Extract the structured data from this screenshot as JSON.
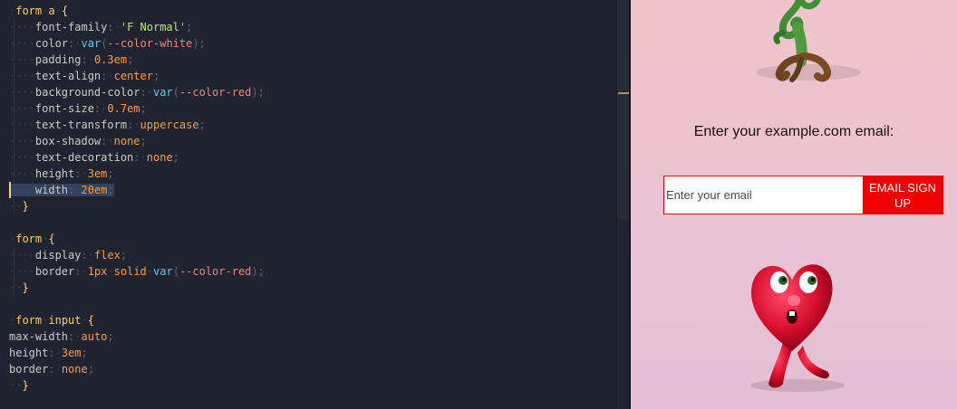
{
  "editor": {
    "lines": [
      [
        {
          "t": "·",
          "c": "ws"
        },
        {
          "t": "form",
          "c": "sel"
        },
        {
          "t": "·",
          "c": "ws"
        },
        {
          "t": "a",
          "c": "sel"
        },
        {
          "t": "·",
          "c": "ws"
        },
        {
          "t": "{",
          "c": "brace"
        }
      ],
      [
        {
          "t": "····",
          "c": "ws"
        },
        {
          "t": "font-family",
          "c": "prop"
        },
        {
          "t": ":",
          "c": "punc"
        },
        {
          "t": "·",
          "c": "ws"
        },
        {
          "t": "'F Normal'",
          "c": "str"
        },
        {
          "t": ";",
          "c": "punc"
        }
      ],
      [
        {
          "t": "····",
          "c": "ws"
        },
        {
          "t": "color",
          "c": "prop"
        },
        {
          "t": ":",
          "c": "punc"
        },
        {
          "t": "·",
          "c": "ws"
        },
        {
          "t": "var",
          "c": "fn"
        },
        {
          "t": "(",
          "c": "punc"
        },
        {
          "t": "--color-white",
          "c": "varname"
        },
        {
          "t": ");",
          "c": "punc"
        }
      ],
      [
        {
          "t": "····",
          "c": "ws"
        },
        {
          "t": "padding",
          "c": "prop"
        },
        {
          "t": ":",
          "c": "punc"
        },
        {
          "t": "·",
          "c": "ws"
        },
        {
          "t": "0.3em",
          "c": "val"
        },
        {
          "t": ";",
          "c": "punc"
        }
      ],
      [
        {
          "t": "····",
          "c": "ws"
        },
        {
          "t": "text-align",
          "c": "prop"
        },
        {
          "t": ":",
          "c": "punc"
        },
        {
          "t": "·",
          "c": "ws"
        },
        {
          "t": "center",
          "c": "val"
        },
        {
          "t": ";",
          "c": "punc"
        }
      ],
      [
        {
          "t": "····",
          "c": "ws"
        },
        {
          "t": "background-color",
          "c": "prop"
        },
        {
          "t": ":",
          "c": "punc"
        },
        {
          "t": "·",
          "c": "ws"
        },
        {
          "t": "var",
          "c": "fn"
        },
        {
          "t": "(",
          "c": "punc"
        },
        {
          "t": "--color-red",
          "c": "varname"
        },
        {
          "t": ");",
          "c": "punc"
        }
      ],
      [
        {
          "t": "····",
          "c": "ws"
        },
        {
          "t": "font-size",
          "c": "prop"
        },
        {
          "t": ":",
          "c": "punc"
        },
        {
          "t": "·",
          "c": "ws"
        },
        {
          "t": "0.7em",
          "c": "val"
        },
        {
          "t": ";",
          "c": "punc"
        }
      ],
      [
        {
          "t": "····",
          "c": "ws"
        },
        {
          "t": "text-transform",
          "c": "prop"
        },
        {
          "t": ":",
          "c": "punc"
        },
        {
          "t": "·",
          "c": "ws"
        },
        {
          "t": "uppercase",
          "c": "val"
        },
        {
          "t": ";",
          "c": "punc"
        }
      ],
      [
        {
          "t": "····",
          "c": "ws"
        },
        {
          "t": "box-shadow",
          "c": "prop"
        },
        {
          "t": ":",
          "c": "punc"
        },
        {
          "t": "·",
          "c": "ws"
        },
        {
          "t": "none",
          "c": "val"
        },
        {
          "t": ";",
          "c": "punc"
        }
      ],
      [
        {
          "t": "····",
          "c": "ws"
        },
        {
          "t": "text-decoration",
          "c": "prop"
        },
        {
          "t": ":",
          "c": "punc"
        },
        {
          "t": "·",
          "c": "ws"
        },
        {
          "t": "none",
          "c": "val"
        },
        {
          "t": ";",
          "c": "punc"
        }
      ],
      [
        {
          "t": "····",
          "c": "ws"
        },
        {
          "t": "height",
          "c": "prop"
        },
        {
          "t": ":",
          "c": "punc"
        },
        {
          "t": "·",
          "c": "ws"
        },
        {
          "t": "3em",
          "c": "val"
        },
        {
          "t": ";",
          "c": "punc"
        }
      ],
      [
        {
          "t": "····",
          "c": "ws"
        },
        {
          "t": "width",
          "c": "prop"
        },
        {
          "t": ":",
          "c": "punc"
        },
        {
          "t": "·",
          "c": "ws"
        },
        {
          "t": "20em",
          "c": "val"
        },
        {
          "t": ";",
          "c": "punc"
        }
      ],
      [
        {
          "t": "··",
          "c": "ws"
        },
        {
          "t": "}",
          "c": "brace"
        }
      ],
      [],
      [
        {
          "t": "·",
          "c": "ws"
        },
        {
          "t": "form",
          "c": "sel"
        },
        {
          "t": "·",
          "c": "ws"
        },
        {
          "t": "{",
          "c": "brace"
        }
      ],
      [
        {
          "t": "····",
          "c": "ws"
        },
        {
          "t": "display",
          "c": "prop"
        },
        {
          "t": ":",
          "c": "punc"
        },
        {
          "t": "·",
          "c": "ws"
        },
        {
          "t": "flex",
          "c": "val"
        },
        {
          "t": ";",
          "c": "punc"
        }
      ],
      [
        {
          "t": "····",
          "c": "ws"
        },
        {
          "t": "border",
          "c": "prop"
        },
        {
          "t": ":",
          "c": "punc"
        },
        {
          "t": "·",
          "c": "ws"
        },
        {
          "t": "1px",
          "c": "val"
        },
        {
          "t": "·",
          "c": "ws"
        },
        {
          "t": "solid",
          "c": "val"
        },
        {
          "t": "·",
          "c": "ws"
        },
        {
          "t": "var",
          "c": "fn"
        },
        {
          "t": "(",
          "c": "punc"
        },
        {
          "t": "--color-red",
          "c": "varname"
        },
        {
          "t": ");",
          "c": "punc"
        }
      ],
      [
        {
          "t": "··",
          "c": "ws"
        },
        {
          "t": "}",
          "c": "brace"
        }
      ],
      [],
      [
        {
          "t": "·",
          "c": "ws"
        },
        {
          "t": "form",
          "c": "sel"
        },
        {
          "t": "·",
          "c": "ws"
        },
        {
          "t": "input",
          "c": "sel"
        },
        {
          "t": "·",
          "c": "ws"
        },
        {
          "t": "{",
          "c": "brace"
        }
      ],
      [
        {
          "t": "max-width",
          "c": "prop"
        },
        {
          "t": ":",
          "c": "punc"
        },
        {
          "t": "·",
          "c": "ws"
        },
        {
          "t": "auto",
          "c": "val"
        },
        {
          "t": ";",
          "c": "punc"
        }
      ],
      [
        {
          "t": "height",
          "c": "prop"
        },
        {
          "t": ":",
          "c": "punc"
        },
        {
          "t": "·",
          "c": "ws"
        },
        {
          "t": "3em",
          "c": "val"
        },
        {
          "t": ";",
          "c": "punc"
        }
      ],
      [
        {
          "t": "border",
          "c": "prop"
        },
        {
          "t": ":",
          "c": "punc"
        },
        {
          "t": "·",
          "c": "ws"
        },
        {
          "t": "none",
          "c": "val"
        },
        {
          "t": ";",
          "c": "punc"
        }
      ],
      [
        {
          "t": "··",
          "c": "ws"
        },
        {
          "t": "}",
          "c": "brace"
        }
      ]
    ],
    "active_line": 11,
    "colors": {
      "background": "#1f2430",
      "selector": "#ffcc66",
      "property": "#cbccc6",
      "value": "#ff9940",
      "string": "#bae67e",
      "function": "#5ccfe6",
      "variable": "#f28779"
    }
  },
  "preview": {
    "prompt_text": "Enter your example.com email:",
    "email_placeholder": "Enter your email",
    "signup_label": "Email sign up",
    "colors": {
      "red": "#f00000",
      "background_top": "#f1c4cc",
      "background_bottom": "#e4bfd3"
    },
    "illustrations": [
      "plant-creature-illustration",
      "heart-character-illustration"
    ]
  }
}
